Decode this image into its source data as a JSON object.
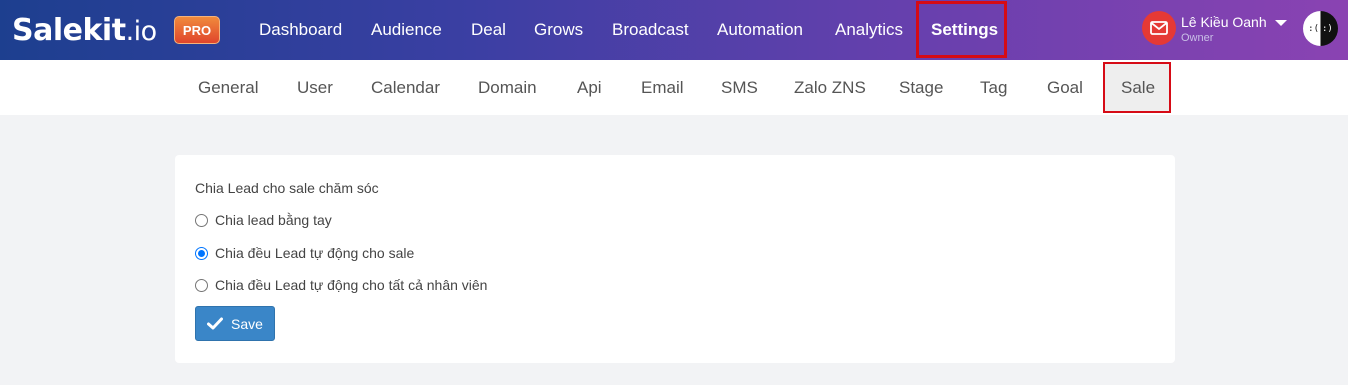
{
  "brand": {
    "name": "Salekit",
    "suffix": ".io",
    "badge": "PRO"
  },
  "nav": {
    "items": [
      {
        "label": "Dashboard"
      },
      {
        "label": "Audience"
      },
      {
        "label": "Deal"
      },
      {
        "label": "Grows"
      },
      {
        "label": "Broadcast"
      },
      {
        "label": "Automation"
      },
      {
        "label": "Analytics"
      },
      {
        "label": "Settings",
        "active": true
      }
    ]
  },
  "user": {
    "name": "Lê Kiều Oanh",
    "role": "Owner",
    "avatar_left": ":(",
    "avatar_right": ":)"
  },
  "subnav": {
    "items": [
      {
        "label": "General"
      },
      {
        "label": "User"
      },
      {
        "label": "Calendar"
      },
      {
        "label": "Domain"
      },
      {
        "label": "Api"
      },
      {
        "label": "Email"
      },
      {
        "label": "SMS"
      },
      {
        "label": "Zalo ZNS"
      },
      {
        "label": "Stage"
      },
      {
        "label": "Tag"
      },
      {
        "label": "Goal"
      },
      {
        "label": "Sale",
        "active": true
      }
    ]
  },
  "form": {
    "section_label": "Chia Lead cho sale chăm sóc",
    "options": [
      {
        "label": "Chia lead bằng tay",
        "checked": false
      },
      {
        "label": "Chia đều Lead tự động cho sale",
        "checked": true
      },
      {
        "label": "Chia đều Lead tự động cho tất cả nhân viên",
        "checked": false
      }
    ],
    "save_label": "Save"
  },
  "colors": {
    "accent": "#3a86c8",
    "highlight": "#d60b16",
    "mail": "#e53935"
  },
  "icons": {
    "mail": "mail-icon",
    "caret": "caret-down-icon",
    "save": "check-icon"
  }
}
